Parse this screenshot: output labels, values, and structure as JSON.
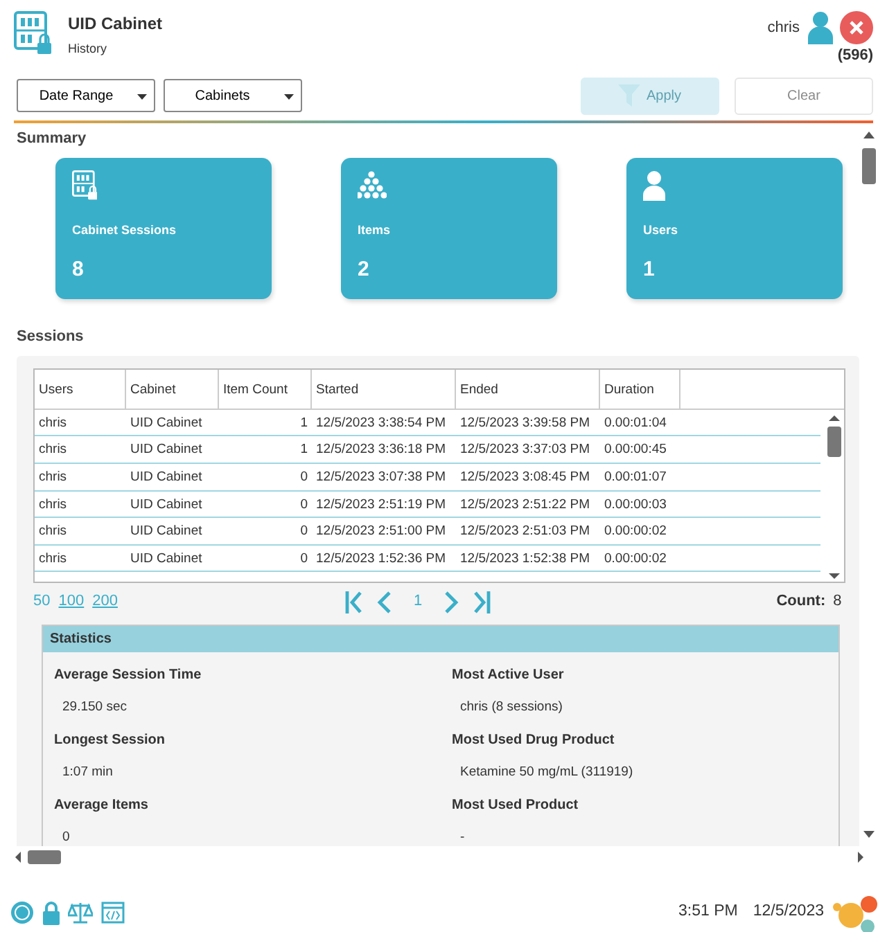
{
  "header": {
    "title": "UID Cabinet",
    "subtitle": "History",
    "user": "chris",
    "count": "(596)"
  },
  "filters": [
    {
      "label": "Date Range"
    },
    {
      "label": "Cabinets"
    }
  ],
  "actions": [
    {
      "kind": "filter",
      "label": "Apply",
      "disabled": true
    },
    {
      "kind": "plain",
      "label": "Clear",
      "disabled": true
    }
  ],
  "summary": {
    "heading": "Summary",
    "cards": [
      {
        "kind": "cabinet",
        "label": "Cabinet Sessions",
        "value": "8"
      },
      {
        "kind": "items",
        "label": "Items",
        "value": "2"
      },
      {
        "kind": "users",
        "label": "Users",
        "value": "1"
      }
    ]
  },
  "sessions": {
    "heading": "Sessions",
    "table": {
      "columns": [
        "Users",
        "Cabinet",
        "Item Count",
        "Started",
        "Ended",
        "Duration"
      ],
      "rows": [
        [
          "chris",
          "UID Cabinet",
          "1",
          "12/5/2023 3:38:54 PM",
          "12/5/2023 3:39:58 PM",
          "0.00:01:04"
        ],
        [
          "chris",
          "UID Cabinet",
          "1",
          "12/5/2023 3:36:18 PM",
          "12/5/2023 3:37:03 PM",
          "0.00:00:45"
        ],
        [
          "chris",
          "UID Cabinet",
          "0",
          "12/5/2023 3:07:38 PM",
          "12/5/2023 3:08:45 PM",
          "0.00:01:07"
        ],
        [
          "chris",
          "UID Cabinet",
          "0",
          "12/5/2023 2:51:19 PM",
          "12/5/2023 2:51:22 PM",
          "0.00:00:03"
        ],
        [
          "chris",
          "UID Cabinet",
          "0",
          "12/5/2023 2:51:00 PM",
          "12/5/2023 2:51:03 PM",
          "0.00:00:02"
        ],
        [
          "chris",
          "UID Cabinet",
          "0",
          "12/5/2023 1:52:36 PM",
          "12/5/2023 1:52:38 PM",
          "0.00:00:02"
        ]
      ]
    },
    "page_sizes": [
      {
        "label": "50",
        "selected": true
      },
      {
        "label": "100",
        "selected": false
      },
      {
        "label": "200",
        "selected": false
      }
    ],
    "page": "1",
    "count_label": "Count:",
    "count": "8"
  },
  "statistics": {
    "title": "Statistics",
    "items": [
      {
        "label": "Average Session Time",
        "value": "29.150 sec"
      },
      {
        "label": "Most Active User",
        "value": "chris (8 sessions)"
      },
      {
        "label": "Longest Session",
        "value": "1:07 min"
      },
      {
        "label": "Most Used Drug Product",
        "value": "Ketamine 50 mg/mL (311919)"
      },
      {
        "label": "Average Items",
        "value": "0"
      },
      {
        "label": "Most Used Product",
        "value": "-"
      }
    ]
  },
  "footer": {
    "time": "3:51 PM",
    "date": "12/5/2023"
  }
}
